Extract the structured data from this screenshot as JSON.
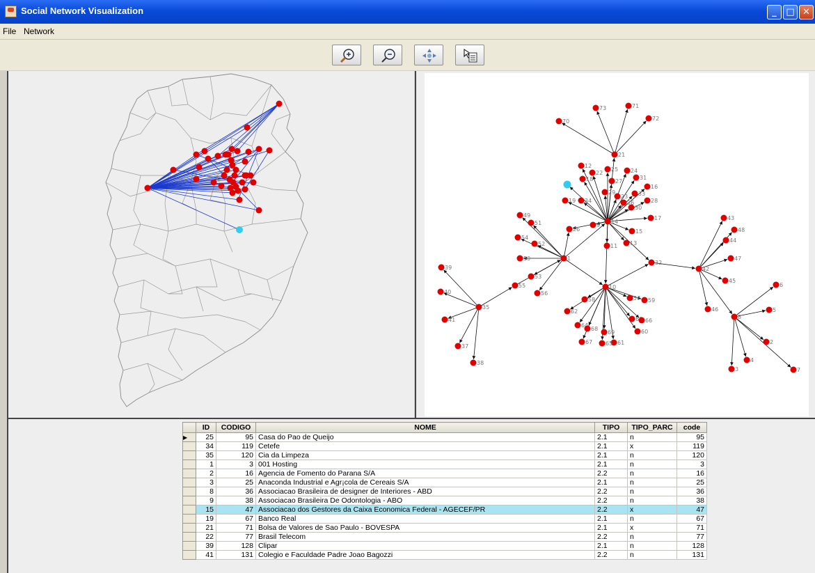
{
  "window": {
    "title": "Social Network Visualization"
  },
  "menu": [
    "File",
    "Network"
  ],
  "toolbar": {
    "buttons": [
      {
        "name": "zoom-in-button",
        "icon": "zoom-in-icon"
      },
      {
        "name": "zoom-out-button",
        "icon": "zoom-out-icon"
      },
      {
        "name": "pan-button",
        "icon": "pan-icon"
      },
      {
        "name": "select-button",
        "icon": "select-pointer-icon"
      }
    ]
  },
  "colors": {
    "node": "#e00000",
    "highlight": "#33ccee",
    "edge_map": "#1a3acc",
    "edge_graph": "#111111",
    "selection_row": "#a9e4f2"
  },
  "graph": {
    "node_labels": [
      "1",
      "2",
      "3",
      "4",
      "5",
      "6",
      "7",
      "8",
      "9",
      "10",
      "11",
      "12",
      "13",
      "14",
      "15",
      "16",
      "17",
      "18",
      "19",
      "20",
      "21",
      "22",
      "23",
      "24",
      "25",
      "26",
      "27",
      "28",
      "29",
      "30",
      "31",
      "32",
      "33",
      "34",
      "35",
      "36",
      "37",
      "38",
      "39",
      "40",
      "41",
      "42",
      "43",
      "44",
      "45",
      "46",
      "47",
      "48",
      "49",
      "50",
      "51",
      "52",
      "53",
      "54",
      "55",
      "56",
      "57",
      "58",
      "59",
      "60",
      "61",
      "62",
      "63",
      "64",
      "65",
      "66",
      "67",
      "68",
      "69",
      "70",
      "71",
      "72",
      "73",
      "74"
    ]
  },
  "table": {
    "columns": [
      "ID",
      "CODIGO",
      "NOME",
      "TIPO",
      "TIPO_PARC",
      "code"
    ],
    "rows": [
      [
        "25",
        "95",
        "Casa do Pao de Queijo",
        "2.1",
        "n",
        "95"
      ],
      [
        "34",
        "119",
        "Cetefe",
        "2.1",
        "x",
        "119"
      ],
      [
        "35",
        "120",
        "Cia da Limpeza",
        "2.1",
        "n",
        "120"
      ],
      [
        "1",
        "3",
        "001 Hosting",
        "2.1",
        "n",
        "3"
      ],
      [
        "2",
        "16",
        "Agencia de Fomento do Parana S/A",
        "2.2",
        "n",
        "16"
      ],
      [
        "3",
        "25",
        "Anaconda Industrial e Agr¡cola de Cereais S/A",
        "2.1",
        "n",
        "25"
      ],
      [
        "8",
        "36",
        "Associacao Brasileira de designer de Interiores - ABD",
        "2.2",
        "n",
        "36"
      ],
      [
        "9",
        "38",
        "Associacao Brasileira De Odontologia - ABO",
        "2.2",
        "n",
        "38"
      ],
      [
        "15",
        "47",
        "Associacao dos Gestores da Caixa Economica Federal - AGECEF/PR",
        "2.2",
        "x",
        "47"
      ],
      [
        "19",
        "67",
        "Banco Real",
        "2.1",
        "n",
        "67"
      ],
      [
        "21",
        "71",
        "Bolsa de Valores de Sao Paulo - BOVESPA",
        "2.1",
        "x",
        "71"
      ],
      [
        "22",
        "77",
        "Brasil Telecom",
        "2.2",
        "n",
        "77"
      ],
      [
        "39",
        "128",
        "Clipar",
        "2.1",
        "n",
        "128"
      ],
      [
        "41",
        "131",
        "Colegio e Faculdade Padre Joao Bagozzi",
        "2.2",
        "n",
        "131"
      ]
    ],
    "selected_index": 8,
    "current_index": 0
  }
}
